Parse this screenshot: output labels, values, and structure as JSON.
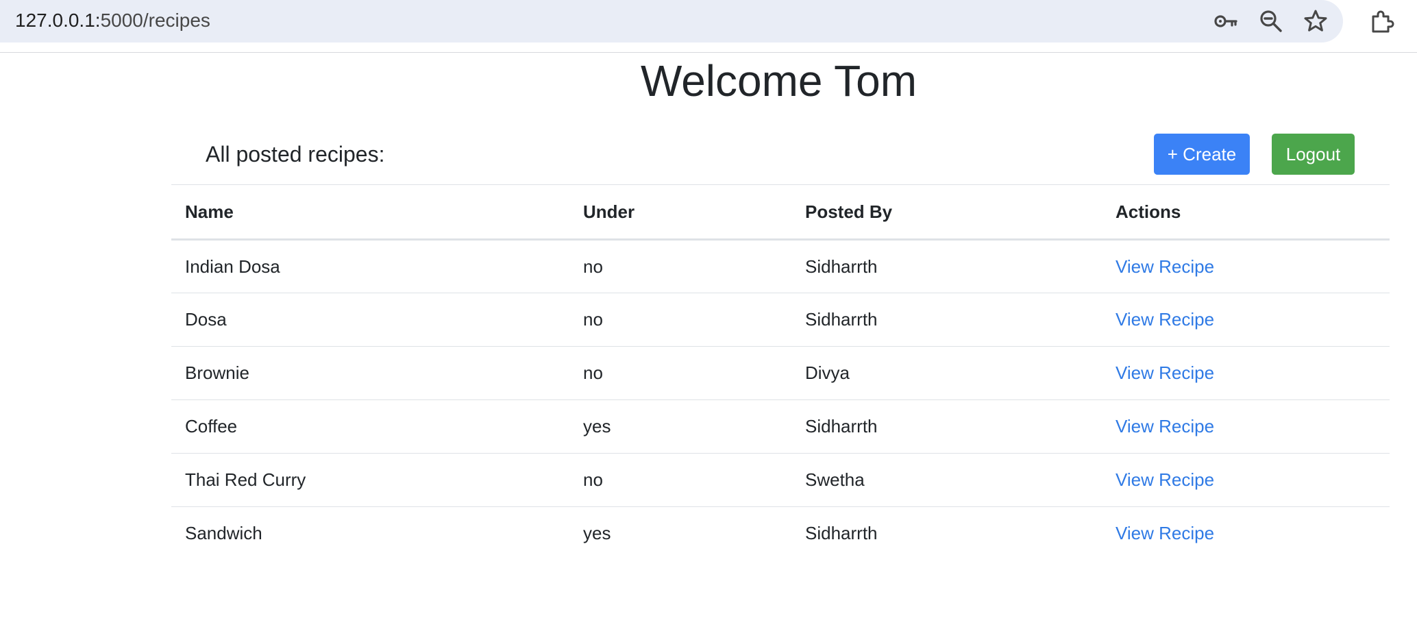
{
  "browser": {
    "url_host": "127.0.0.1:",
    "url_path": "5000/recipes",
    "icons": [
      "key-icon",
      "zoom-out-icon",
      "star-icon",
      "extensions-icon"
    ]
  },
  "page": {
    "title": "Welcome Tom",
    "section_label": "All posted recipes:",
    "create_label": "+ Create",
    "logout_label": "Logout"
  },
  "table": {
    "headers": {
      "name": "Name",
      "under": "Under",
      "posted_by": "Posted By",
      "actions": "Actions"
    },
    "rows": [
      {
        "name": "Indian Dosa",
        "under": "no",
        "posted_by": "Sidharrth",
        "action": "View Recipe"
      },
      {
        "name": "Dosa",
        "under": "no",
        "posted_by": "Sidharrth",
        "action": "View Recipe"
      },
      {
        "name": "Brownie",
        "under": "no",
        "posted_by": "Divya",
        "action": "View Recipe"
      },
      {
        "name": "Coffee",
        "under": "yes",
        "posted_by": "Sidharrth",
        "action": "View Recipe"
      },
      {
        "name": "Thai Red Curry",
        "under": "no",
        "posted_by": "Swetha",
        "action": "View Recipe"
      },
      {
        "name": "Sandwich",
        "under": "yes",
        "posted_by": "Sidharrth",
        "action": "View Recipe"
      }
    ]
  },
  "colors": {
    "create_button": "#3b82f6",
    "logout_button": "#4ca64c",
    "link": "#2f7ae5"
  }
}
